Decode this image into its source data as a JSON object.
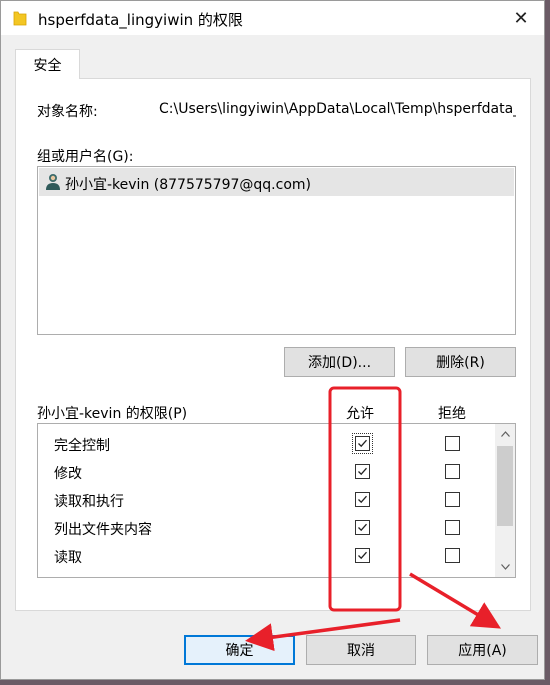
{
  "window": {
    "title": "hsperfdata_lingyiwin 的权限",
    "close_symbol": "✕"
  },
  "tabs": [
    {
      "label": "安全",
      "selected": true
    }
  ],
  "object": {
    "label": "对象名称:",
    "path": "C:\\Users\\lingyiwin\\AppData\\Local\\Temp\\hsperfdata_lingyiwin"
  },
  "groups": {
    "label": "组或用户名(G):",
    "users": [
      {
        "name": "孙小宜-kevin (877575797@qq.com)",
        "icon": "user-icon",
        "selected": true
      }
    ],
    "add_button": "添加(D)...",
    "remove_button": "删除(R)"
  },
  "permissions": {
    "label": "孙小宜-kevin 的权限(P)",
    "allow_header": "允许",
    "deny_header": "拒绝",
    "rows": [
      {
        "name": "完全控制",
        "allow": true,
        "deny": false
      },
      {
        "name": "修改",
        "allow": true,
        "deny": false
      },
      {
        "name": "读取和执行",
        "allow": true,
        "deny": false
      },
      {
        "name": "列出文件夹内容",
        "allow": true,
        "deny": false
      },
      {
        "name": "读取",
        "allow": true,
        "deny": false
      }
    ]
  },
  "footer": {
    "ok": "确定",
    "cancel": "取消",
    "apply": "应用(A)"
  },
  "colors": {
    "annotation_red": "#e8202a",
    "focus_blue": "#0078d7"
  }
}
